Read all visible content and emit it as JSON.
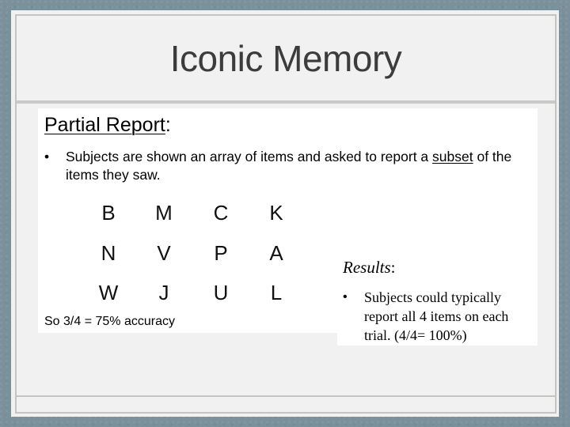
{
  "slide": {
    "title": "Iconic Memory",
    "section_heading": "Partial Report",
    "section_heading_suffix": ":",
    "bullet_marker": "•",
    "bullet1_text_before": "Subjects are shown an array of items and asked to report a ",
    "bullet1_underlined": "subset",
    "bullet1_text_after": " of the items they saw.",
    "letter_grid": [
      [
        "B",
        "M",
        "C",
        "K"
      ],
      [
        "N",
        "V",
        "P",
        "A"
      ],
      [
        "W",
        "J",
        "U",
        "L"
      ]
    ],
    "accuracy_text": "So 3/4 = 75% accuracy",
    "results_heading": "Results",
    "results_heading_suffix": ":",
    "results_bullet": "Subjects could typically report all 4 items on each trial. (4/4= 100%)"
  },
  "colors": {
    "background": "#7a919c",
    "panel": "#f1f1f1",
    "frame": "#c4c4c0",
    "title_text": "#3c3c3c",
    "content_box": "#ffffff"
  }
}
